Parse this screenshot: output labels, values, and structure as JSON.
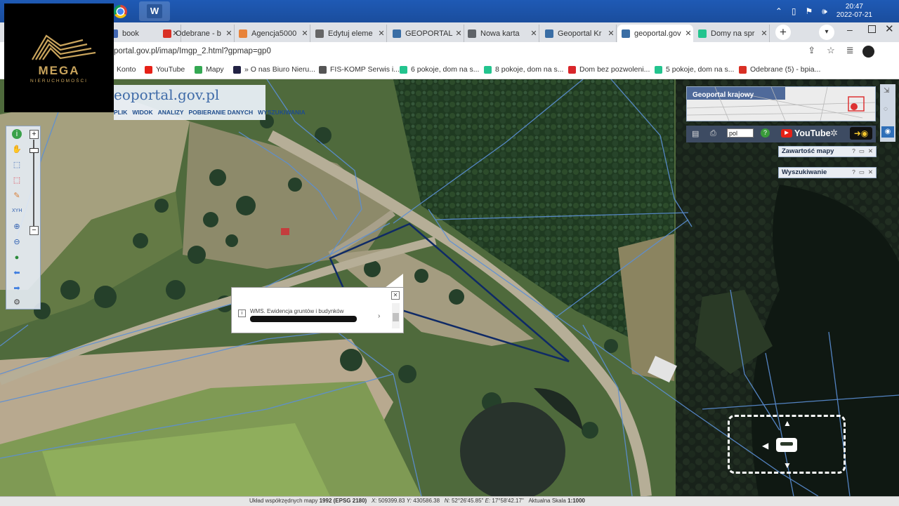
{
  "taskbar": {
    "time": "20:47",
    "date": "2022-07-21"
  },
  "tabs": [
    {
      "label": "book",
      "icon": "facebook-icon",
      "color": "#4267b2"
    },
    {
      "label": "Odebrane - b",
      "icon": "gmail-icon",
      "color": "#d93025"
    },
    {
      "label": "Agencja5000",
      "icon": "agency-icon",
      "color": "#e8833a"
    },
    {
      "label": "Edytuj eleme",
      "icon": "edit-icon",
      "color": "#666666"
    },
    {
      "label": "GEOPORTAL :",
      "icon": "geoportal-icon",
      "color": "#3a6ea5"
    },
    {
      "label": "Nowa karta",
      "icon": "chrome-icon",
      "color": "#5f6368"
    },
    {
      "label": "Geoportal Kr",
      "icon": "geoportal-icon",
      "color": "#3a6ea5"
    },
    {
      "label": "geoportal.gov",
      "icon": "geoportal-icon",
      "color": "#3a6ea5"
    },
    {
      "label": "Domy na spr",
      "icon": "otodom-icon",
      "color": "#23c48e"
    }
  ],
  "address": {
    "url": "portal.gov.pl/imap/Imgp_2.html?gpmap=gp0"
  },
  "bookmarks": [
    {
      "label": "Konto",
      "icon": "account-icon",
      "color": "#777777"
    },
    {
      "label": "YouTube",
      "icon": "youtube-icon",
      "color": "#e62117"
    },
    {
      "label": "Mapy",
      "icon": "maps-icon",
      "color": "#34a853"
    },
    {
      "label": "» O nas Biuro Nieru...",
      "icon": "office-icon",
      "color": "#222244"
    },
    {
      "label": "FIS-KOMP Serwis i...",
      "icon": "globe-icon",
      "color": "#555555"
    },
    {
      "label": "6 pokoje, dom na s...",
      "icon": "otodom-icon",
      "color": "#23c48e"
    },
    {
      "label": "8 pokoje, dom na s...",
      "icon": "otodom-icon",
      "color": "#23c48e"
    },
    {
      "label": "Dom bez pozwoleni...",
      "icon": "d-icon",
      "color": "#d9262b"
    },
    {
      "label": "5 pokoje, dom na s...",
      "icon": "otodom-icon",
      "color": "#23c48e"
    },
    {
      "label": "Odebrane (5) - bpia...",
      "icon": "gmail-icon",
      "color": "#d93025"
    }
  ],
  "logo": {
    "brand": "MEGA",
    "tagline": "NIERUCHOMOŚCI",
    "color": "#c9a45c"
  },
  "geoportal": {
    "title": "eoportal.gov.pl",
    "menu": [
      "PLIK",
      "WIDOK",
      "ANALIZY",
      "POBIERANIE DANYCH",
      "WYSZUKIWANIA"
    ]
  },
  "right_panel": {
    "overview_title": "Geoportal krajowy",
    "language": "pol",
    "youtube": "YouTube",
    "boxes": [
      "Zawartość mapy",
      "Wyszukiwanie"
    ]
  },
  "popup": {
    "layer_text": "WMS. Ewidencja gruntów i budynków"
  },
  "statusbar": {
    "prefix": "Układ współrzędnych mapy",
    "crs": "1992 (EPSG 2180)",
    "x_label": "X:",
    "x": "509399.83",
    "y_label": "Y:",
    "y": "430586.38",
    "n_label": "N:",
    "n": "52°26'45.85\"",
    "e_label": "E:",
    "e": "17°58'42.17\"",
    "scale_label": "Aktualna Skala",
    "scale": "1:1000"
  },
  "colors": {
    "parcel_line": "#5b8fd6",
    "selected_parcel": "#0f2a66",
    "taskbar": "#1f5ab5"
  }
}
